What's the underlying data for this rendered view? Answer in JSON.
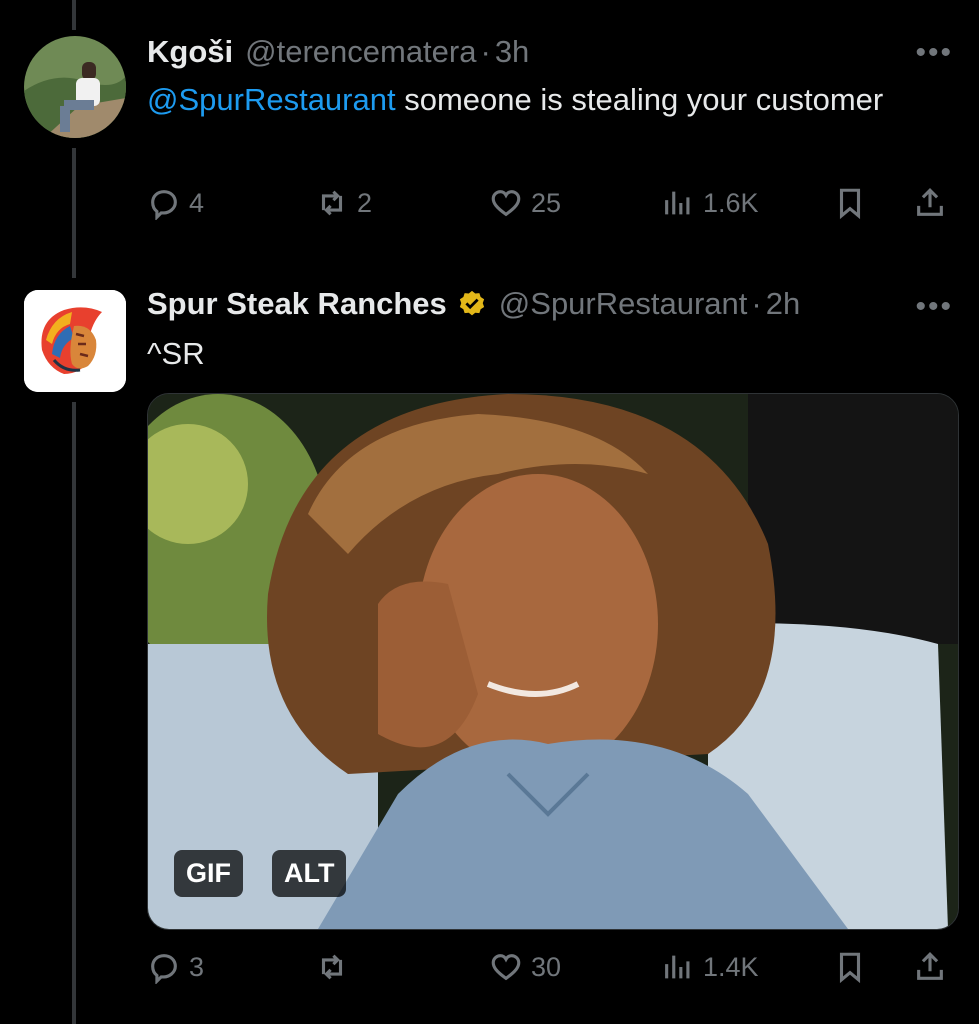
{
  "tweets": [
    {
      "author_name": "Kgoši",
      "handle": "@terencematera",
      "separator": "·",
      "time": "3h",
      "more": "•••",
      "mention": "@SpurRestaurant",
      "text": " someone is stealing your customer",
      "replies": "4",
      "retweets": "2",
      "likes": "25",
      "views": "1.6K"
    },
    {
      "author_name": "Spur Steak Ranches",
      "handle": "@SpurRestaurant",
      "separator": "·",
      "time": "2h",
      "more": "•••",
      "text": "^SR",
      "media_badges": {
        "gif": "GIF",
        "alt": "ALT"
      },
      "replies": "3",
      "retweets": "",
      "likes": "30",
      "views": "1.4K"
    }
  ],
  "colors": {
    "background": "#000000",
    "accent": "#1d9bf0",
    "muted": "#71767b",
    "verified": "#e2b719"
  },
  "icons": [
    "reply-icon",
    "retweet-icon",
    "like-icon",
    "views-icon",
    "bookmark-icon",
    "share-icon",
    "verified-badge-icon",
    "more-icon"
  ]
}
